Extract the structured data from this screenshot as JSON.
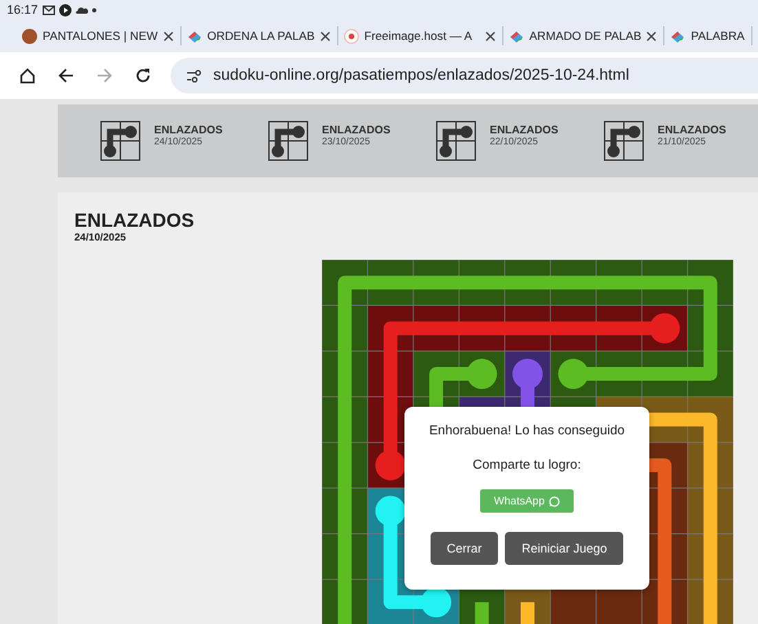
{
  "status_bar": {
    "time": "16:17"
  },
  "tabs": [
    {
      "title": "PANTALONES | NEW",
      "closable": true
    },
    {
      "title": "ORDENA LA PALAB",
      "closable": true
    },
    {
      "title": "Freeimage.host — A",
      "closable": true
    },
    {
      "title": "ARMADO DE PALAB",
      "closable": true
    },
    {
      "title": "PALABRA",
      "closable": false
    }
  ],
  "address_bar": {
    "url": "sudoku-online.org/pasatiempos/enlazados/2025-10-24.html"
  },
  "carousel": [
    {
      "title": "ENLAZADOS",
      "date": "24/10/2025"
    },
    {
      "title": "ENLAZADOS",
      "date": "23/10/2025"
    },
    {
      "title": "ENLAZADOS",
      "date": "22/10/2025"
    },
    {
      "title": "ENLAZADOS",
      "date": "21/10/2025"
    }
  ],
  "puzzle": {
    "title": "ENLAZADOS",
    "date": "24/10/2025"
  },
  "dialog": {
    "message": "Enhorabuena! Lo has conseguido",
    "share_label": "Comparte tu logro:",
    "share_button": "WhatsApp",
    "buttons": [
      "Cerrar",
      "Reiniciar Juego"
    ]
  }
}
